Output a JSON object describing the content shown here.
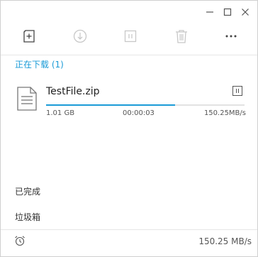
{
  "window": {
    "controls": [
      "minimize-icon",
      "maximize-icon",
      "close-icon"
    ]
  },
  "toolbar": {
    "icons": [
      "new-download-icon",
      "download-icon",
      "pause-icon",
      "trash-icon",
      "more-icon"
    ]
  },
  "downloading": {
    "title": "正在下载 (1)",
    "items": [
      {
        "file_name": "TestFile.zip",
        "size": "1.01 GB",
        "elapsed": "00:00:03",
        "speed": "150.25MB/s",
        "progress": 0.65
      }
    ]
  },
  "nav": {
    "completed": "已完成",
    "trash": "垃圾箱"
  },
  "status": {
    "total_speed": "150.25 MB/s"
  },
  "colors": {
    "accent": "#1a9bd7",
    "disabled_icon": "#c8c8c8"
  }
}
